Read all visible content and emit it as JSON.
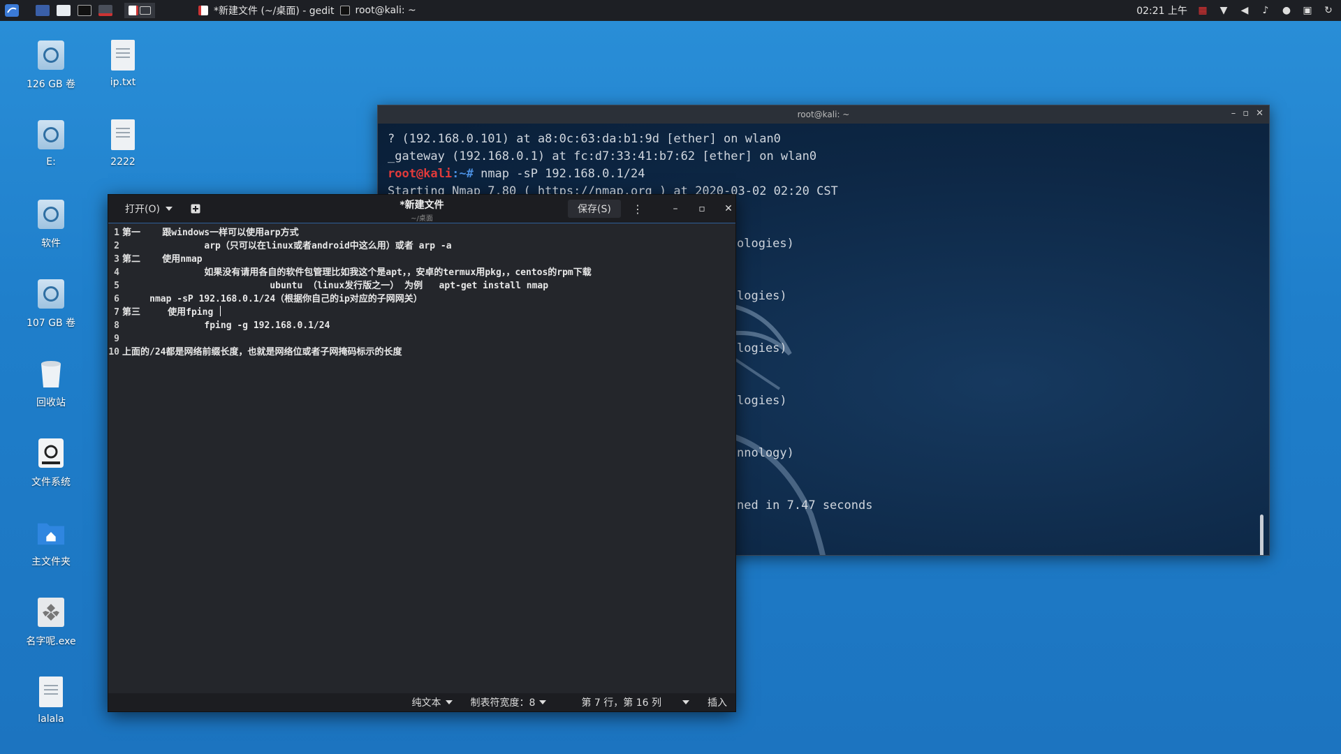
{
  "topbar": {
    "tasks": [
      {
        "label": "*新建文件 (~/桌面) - gedit"
      },
      {
        "label": "root@kali: ~"
      }
    ],
    "clock": "02:21 上午"
  },
  "desktop": {
    "icons": [
      {
        "label": "126 GB 卷",
        "type": "drive"
      },
      {
        "label": "ip.txt",
        "type": "doc"
      },
      {
        "label": "E:",
        "type": "drive"
      },
      {
        "label": "2222",
        "type": "doc"
      },
      {
        "label": "软件",
        "type": "drive"
      },
      {
        "label": "107 GB 卷",
        "type": "drive"
      },
      {
        "label": "回收站",
        "type": "trash"
      },
      {
        "label": "文件系统",
        "type": "fs"
      },
      {
        "label": "主文件夹",
        "type": "home"
      },
      {
        "label": "名字呢.exe",
        "type": "exe"
      },
      {
        "label": "lalala",
        "type": "doc"
      }
    ]
  },
  "terminal": {
    "title": "root@kali: ~",
    "lines": [
      "? (192.168.0.101) at a8:0c:63:da:b1:9d [ether] on wlan0",
      "_gateway (192.168.0.1) at fc:d7:33:41:b7:62 [ether] on wlan0"
    ],
    "prompt_user": "root@kali",
    "prompt_path": ":~#",
    "command": " nmap -sP 192.168.0.1/24",
    "starting_line": "Starting Nmap 7.80 ( https://nmap.org ) at 2020-03-02 02:20 CST",
    "fragments": [
      "ologies)",
      "logies)",
      "logies)",
      "logies)",
      "nnology)",
      "ned in 7.47 seconds"
    ]
  },
  "gedit": {
    "open_label": "打开(O)",
    "title": "*新建文件",
    "subtitle": "~/桌面",
    "save_label": "保存(S)",
    "lines": [
      {
        "num": "1",
        "text": "第一    跟windows一样可以使用arp方式"
      },
      {
        "num": "2",
        "text": "               arp（只可以在linux或者android中这么用）或者 arp -a"
      },
      {
        "num": "3",
        "text": "第二    使用nmap"
      },
      {
        "num": "4",
        "text": "               如果没有请用各自的软件包管理比如我这个是apt，，安卓的termux用pkg，，centos的rpm下载"
      },
      {
        "num": "5",
        "text": "                           ubuntu （linux发行版之一） 为例   apt-get install nmap"
      },
      {
        "num": "6",
        "text": "     nmap -sP 192.168.0.1/24（根据你自己的ip对应的子网网关）"
      },
      {
        "num": "7",
        "text": "第三     使用fping "
      },
      {
        "num": "8",
        "text": "               fping -g 192.168.0.1/24"
      },
      {
        "num": "9",
        "text": ""
      },
      {
        "num": "10",
        "text": "上面的/24都是网络前缀长度，也就是网络位或者子网掩码标示的长度"
      }
    ],
    "status": {
      "lang": "纯文本",
      "tab_width": "制表符宽度：8",
      "position": "第 7 行，第 16 列",
      "mode": "插入"
    }
  },
  "colors": {
    "desktop_bg": "#1f7fcb",
    "terminal_bg": "#0d2745",
    "prompt_red": "#e23b3b",
    "prompt_blue": "#4a8fe0",
    "editor_bg": "#24262b"
  }
}
